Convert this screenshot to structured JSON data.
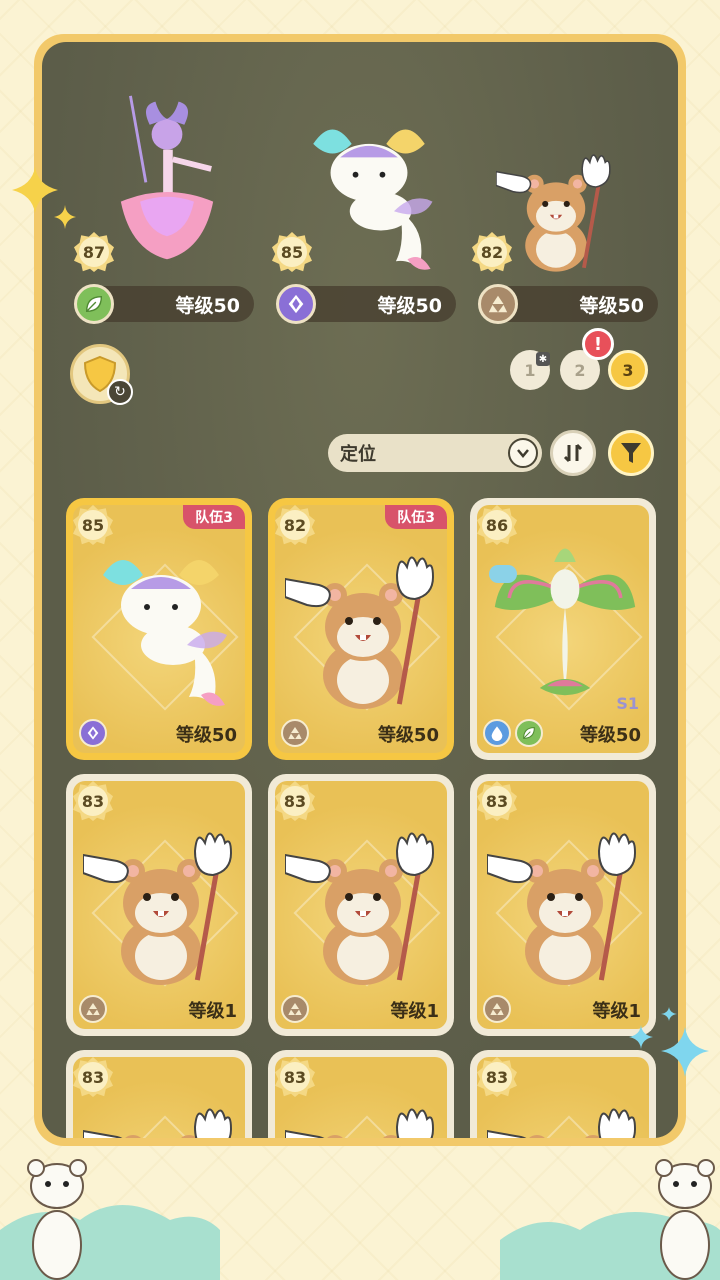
{
  "team": [
    {
      "power": "87",
      "level": "等级50",
      "type": "grass-type-icon",
      "creature": "flower-dancer"
    },
    {
      "power": "85",
      "level": "等级50",
      "type": "psychic-type-icon",
      "creature": "butterfly-cat"
    },
    {
      "power": "82",
      "level": "等级50",
      "type": "normal-type-icon",
      "creature": "hamster"
    }
  ],
  "team_selector": {
    "options": [
      "1",
      "2",
      "3"
    ],
    "selected": "3",
    "alert": "!"
  },
  "sort": {
    "label": "定位"
  },
  "cards": [
    {
      "power": "85",
      "tag": "队伍3",
      "level": "等级50",
      "selected": true,
      "creature": "butterfly-cat"
    },
    {
      "power": "82",
      "tag": "队伍3",
      "level": "等级50",
      "selected": true,
      "creature": "hamster"
    },
    {
      "power": "86",
      "tag": "",
      "level": "等级50",
      "selected": false,
      "creature": "leaf-bird",
      "season": "S1"
    },
    {
      "power": "83",
      "tag": "",
      "level": "等级1",
      "selected": false,
      "creature": "hamster"
    },
    {
      "power": "83",
      "tag": "",
      "level": "等级1",
      "selected": false,
      "creature": "hamster"
    },
    {
      "power": "83",
      "tag": "",
      "level": "等级1",
      "selected": false,
      "creature": "hamster"
    },
    {
      "power": "83",
      "tag": "",
      "level": "",
      "selected": false,
      "creature": "hamster"
    },
    {
      "power": "83",
      "tag": "",
      "level": "",
      "selected": false,
      "creature": "hamster"
    },
    {
      "power": "83",
      "tag": "",
      "level": "",
      "selected": false,
      "creature": "hamster"
    }
  ],
  "colors": {
    "frame": "#f2c96a",
    "panel": "#5c5d49",
    "team_tag": "#d8536a",
    "accent": "#f6c743"
  }
}
